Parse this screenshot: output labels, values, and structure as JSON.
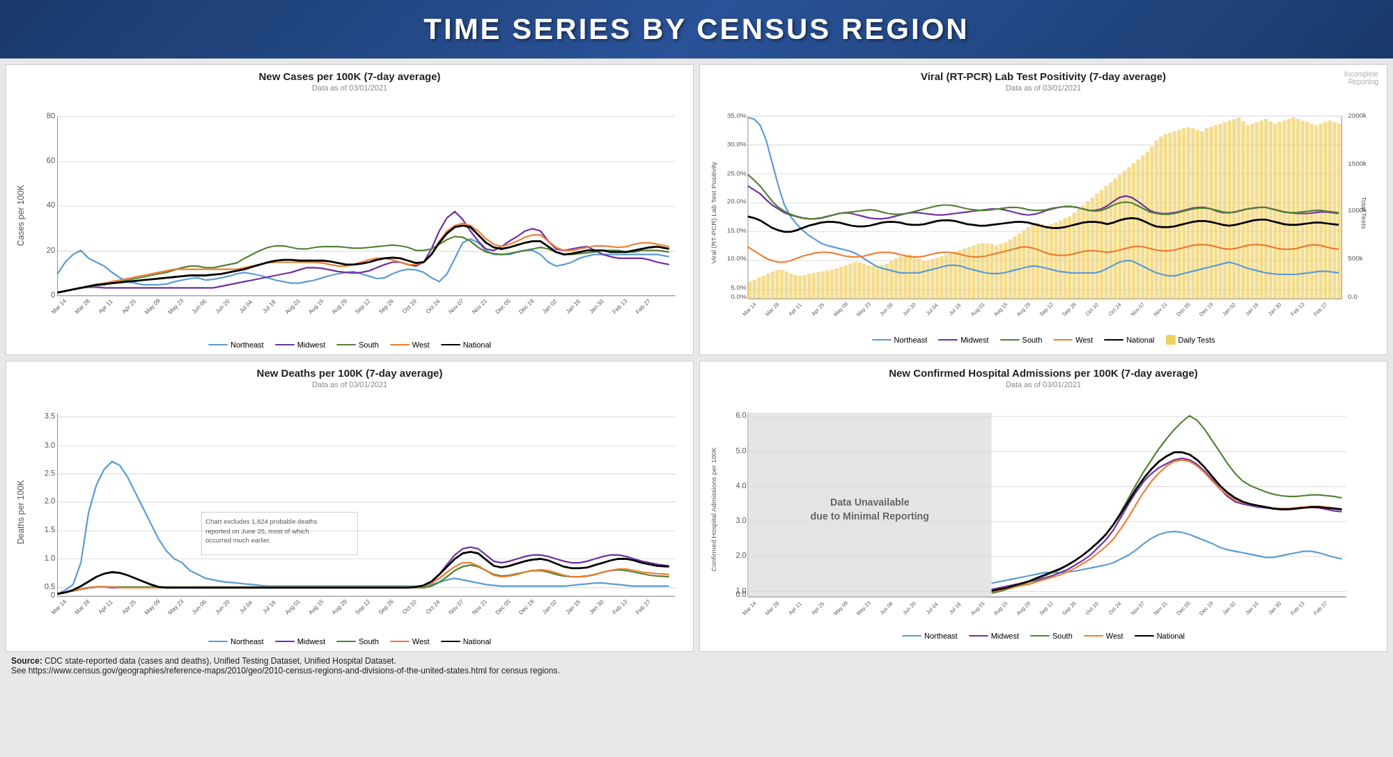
{
  "header": {
    "title": "TIME SERIES BY CENSUS REGION"
  },
  "charts": {
    "top_left": {
      "title": "New Cases per 100K (7-day average)",
      "subtitle": "Data as of 03/01/2021",
      "y_label": "Cases per 100K",
      "y_ticks": [
        "80",
        "60",
        "40",
        "20",
        "0"
      ],
      "x_ticks": [
        "Mar 14",
        "Mar 28",
        "Apr 11",
        "Apr 25",
        "May 09",
        "May 23",
        "Jun 06",
        "Jun 20",
        "Jul 04",
        "Jul 18",
        "Aug 01",
        "Aug 15",
        "Aug 29",
        "Sep 12",
        "Sep 26",
        "Oct 10",
        "Oct 24",
        "Nov 07",
        "Nov 21",
        "Dec 05",
        "Dec 19",
        "Jan 02",
        "Jan 16",
        "Jan 30",
        "Feb 13",
        "Feb 27"
      ]
    },
    "top_right": {
      "title": "Viral (RT-PCR) Lab Test Positivity (7-day average)",
      "subtitle": "Data as of 03/01/2021",
      "incomplete_label": "Incomplete\nReporting",
      "y_label": "Viral (RT-PCR) Lab Test Positivity",
      "y_ticks_left": [
        "35.0%",
        "30.0%",
        "25.0%",
        "20.0%",
        "15.0%",
        "10.0%",
        "5.0%",
        "0.0%"
      ],
      "y_ticks_right": [
        "2000k",
        "1500k",
        "1000k",
        "500k",
        "0.0"
      ],
      "y_right_label": "Total Tests"
    },
    "bottom_left": {
      "title": "New Deaths per 100K (7-day average)",
      "subtitle": "Data as of 03/01/2021",
      "y_label": "Deaths per 100K",
      "y_ticks": [
        "3.5",
        "3.0",
        "2.5",
        "2.0",
        "1.5",
        "1.0",
        "0.5",
        "0"
      ],
      "annotation": "Chart excludes 1,824 probable deaths\nreported on June 25, most of which\noccurred much earlier."
    },
    "bottom_right": {
      "title": "New Confirmed Hospital Admissions per 100K (7-day average)",
      "subtitle": "Data as of 03/01/2021",
      "y_label": "Confirmed Hospital Admissions per 100K",
      "y_ticks": [
        "6.0",
        "5.0",
        "4.0",
        "3.0",
        "2.0",
        "1.0",
        "0.0"
      ],
      "unavailable_text": "Data Unavailable\ndue to Minimal Reporting"
    }
  },
  "legend": {
    "items": [
      {
        "label": "Northeast",
        "color": "#5b9bd5"
      },
      {
        "label": "Midwest",
        "color": "#7030a0"
      },
      {
        "label": "South",
        "color": "#538135"
      },
      {
        "label": "West",
        "color": "#ed7d31"
      },
      {
        "label": "National",
        "color": "#000000"
      }
    ],
    "top_right_extra": {
      "label": "Daily Tests",
      "color": "#f0d060"
    }
  },
  "source": {
    "text1": "Source: CDC state-reported data (cases and deaths), Unified Testing Dataset, Unified Hospital Dataset.",
    "text2": "See https://www.census.gov/geographies/reference-maps/2010/geo/2010-census-regions-and-divisions-of-the-united-states.html for census regions."
  }
}
